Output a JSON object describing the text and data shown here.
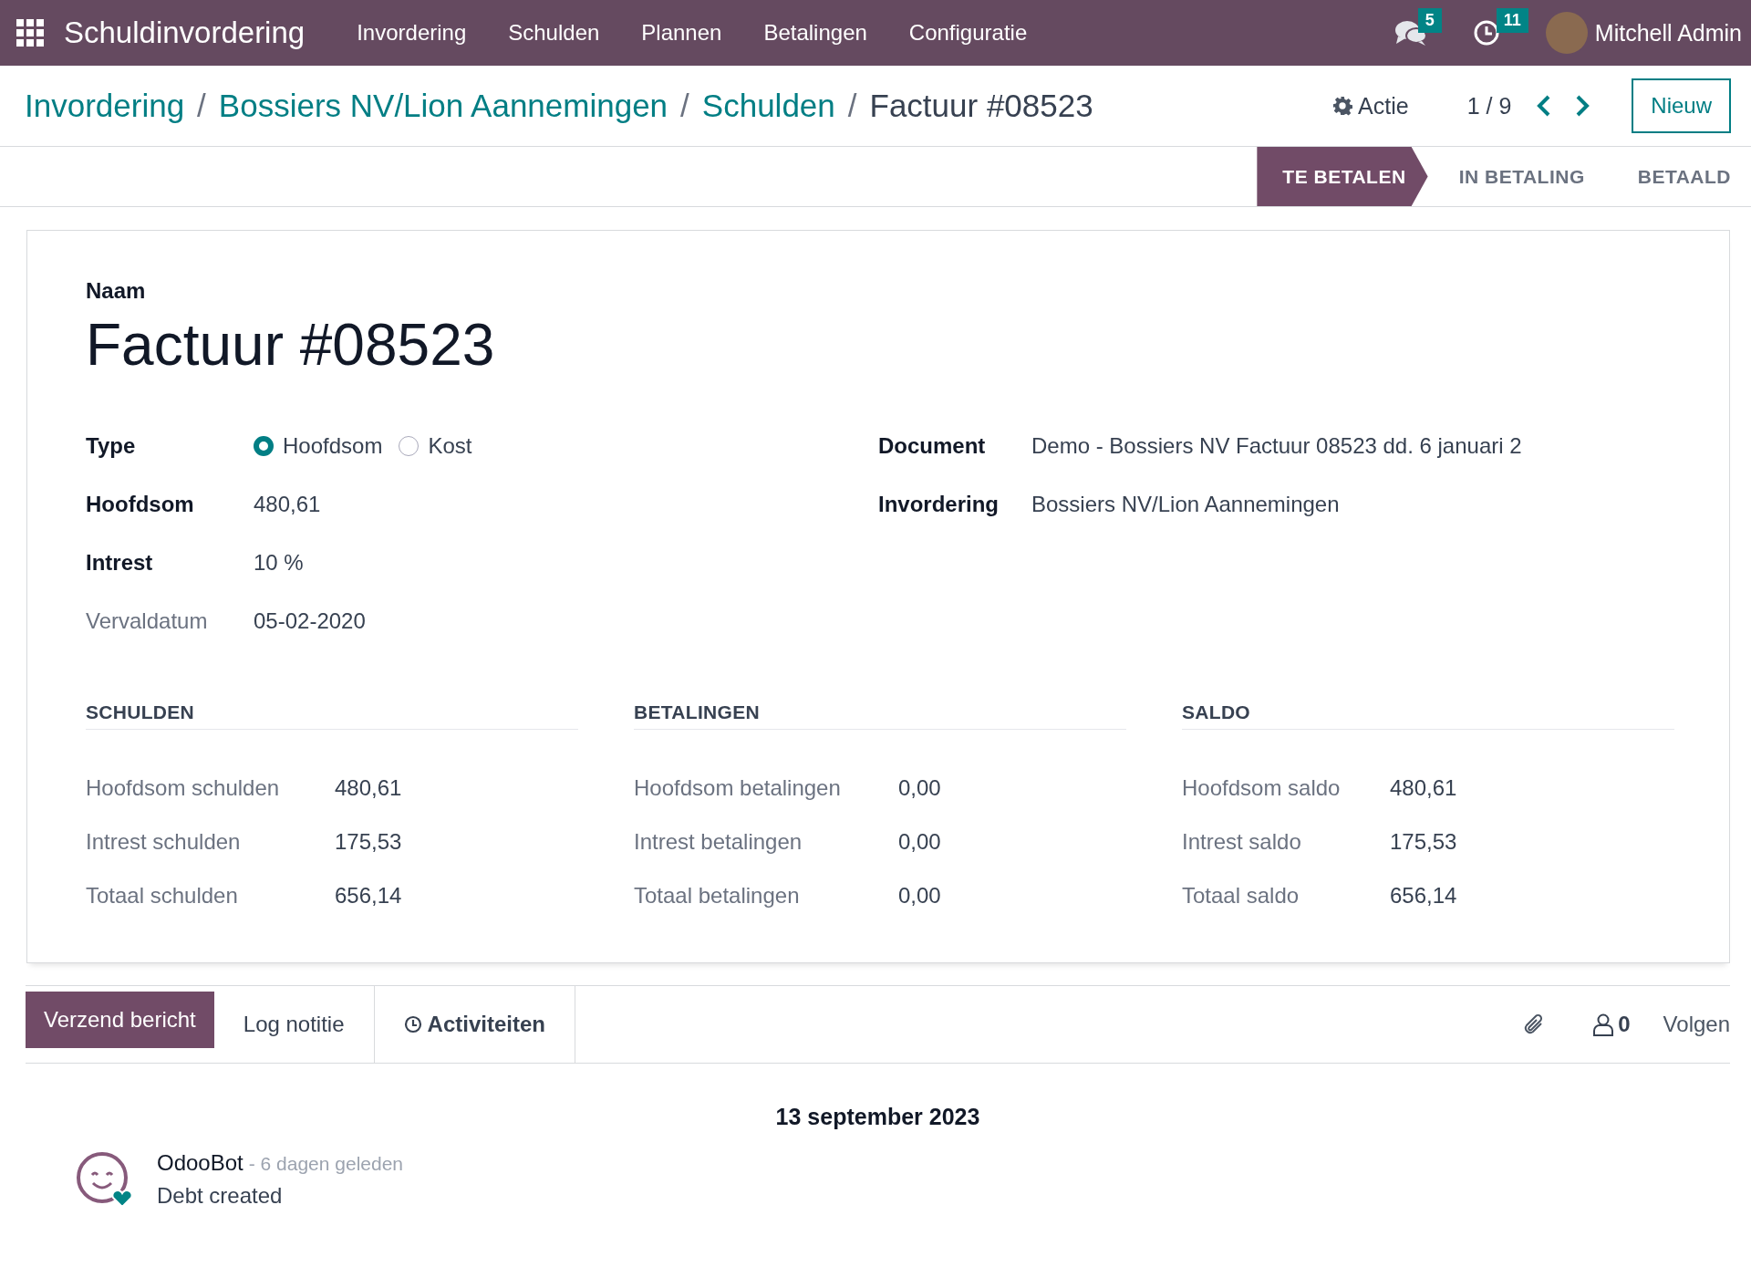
{
  "navbar": {
    "app_name": "Schuldinvordering",
    "menu": [
      "Invordering",
      "Schulden",
      "Plannen",
      "Betalingen",
      "Configuratie"
    ],
    "messages_count": "5",
    "activities_count": "11",
    "user": "Mitchell Admin"
  },
  "breadcrumb": [
    {
      "label": "Invordering",
      "separator": "/"
    },
    {
      "label": "Bossiers NV/Lion Aannemingen",
      "separator": "/"
    },
    {
      "label": "Schulden",
      "separator": "/"
    }
  ],
  "record_title": "Factuur #08523",
  "action": "Actie",
  "pager": "1 / 9",
  "new_button": "Nieuw",
  "stages": [
    {
      "label": "TE BETALEN",
      "selected": true
    },
    {
      "label": "IN BETALING",
      "selected": false
    },
    {
      "label": "BETAALD",
      "selected": false
    }
  ],
  "form": {
    "name_label": "Naam",
    "name": "Factuur #08523",
    "left_fields": [
      {
        "kind": "radio",
        "label": "Type",
        "muted": false,
        "options": [
          {
            "label": "Hoofdsom",
            "selected": true
          },
          {
            "label": "Kost",
            "selected": false
          }
        ]
      },
      {
        "kind": "text",
        "label": "Hoofdsom",
        "muted": false,
        "value": "480,61"
      },
      {
        "kind": "text",
        "label": "Intrest",
        "muted": false,
        "value": "10 %"
      },
      {
        "kind": "text",
        "label": "Vervaldatum",
        "muted": true,
        "value": "05-02-2020"
      }
    ],
    "right_fields": [
      {
        "kind": "text",
        "label": "Document",
        "muted": false,
        "value": "Demo - Bossiers NV Factuur 08523 dd. 6 januari 2"
      },
      {
        "kind": "text",
        "label": "Invordering",
        "muted": false,
        "value": "Bossiers NV/Lion Aannemingen"
      }
    ],
    "groups": [
      {
        "title": "SCHULDEN",
        "rows": [
          {
            "label": "Hoofdsom schulden",
            "value": "480,61"
          },
          {
            "label": "Intrest schulden",
            "value": "175,53"
          },
          {
            "label": "Totaal schulden",
            "value": "656,14"
          }
        ]
      },
      {
        "title": "BETALINGEN",
        "rows": [
          {
            "label": "Hoofdsom betalingen",
            "value": "0,00"
          },
          {
            "label": "Intrest betalingen",
            "value": "0,00"
          },
          {
            "label": "Totaal betalingen",
            "value": "0,00"
          }
        ]
      },
      {
        "title": "SALDO",
        "rows": [
          {
            "label": "Hoofdsom saldo",
            "value": "480,61"
          },
          {
            "label": "Intrest saldo",
            "value": "175,53"
          },
          {
            "label": "Totaal saldo",
            "value": "656,14"
          }
        ]
      }
    ]
  },
  "chatter": {
    "send_message": "Verzend bericht",
    "log_note": "Log notitie",
    "activities": "Activiteiten",
    "followers_count": "0",
    "follow": "Volgen",
    "date": "13 september 2023",
    "messages": [
      {
        "author": "OdooBot",
        "time": "- 6 dagen geleden",
        "body": "Debt created"
      }
    ]
  }
}
